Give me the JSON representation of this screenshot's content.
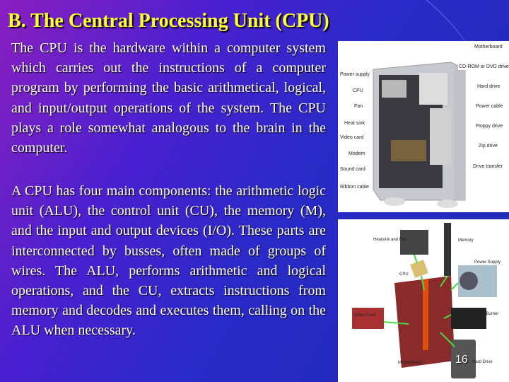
{
  "title": "B. The Central Processing Unit (CPU)",
  "paragraphs": [
    "The CPU is the hardware within a computer system which carries out the instructions of a computer program by performing the basic arithmetical, logical, and input/output operations of the system. The CPU plays a role somewhat analogous to the brain in the computer.",
    "A CPU has four main components: the arithmetic logic unit (ALU), the control unit (CU), the memory (M), and the input and output devices (I/O). These parts are interconnected by busses, often made of groups of wires. The ALU, performs arithmetic and logical operations, and the CU, extracts instructions from memory and decodes and executes them, calling on the ALU when necessary."
  ],
  "case_image": {
    "left_labels": [
      "Power supply",
      "CPU",
      "Fan",
      "Heat sink",
      "Video card",
      "Modem",
      "Sound card",
      "Ribbon cable"
    ],
    "right_labels": [
      "Motherboard",
      "CD-ROM or DVD drive",
      "Hard drive",
      "Power cable",
      "Floppy drive",
      "Zip drive",
      "Drive transfer"
    ]
  },
  "components_image": {
    "labels": [
      "Heatsink and Fan",
      "Memory",
      "CPU",
      "Power Supply",
      "Dvd Burner",
      "Video Card",
      "Hard Drive",
      "Motherboard"
    ]
  },
  "page_number": "16"
}
